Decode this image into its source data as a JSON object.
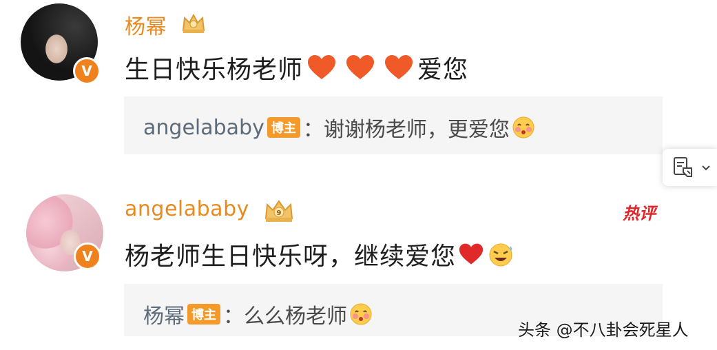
{
  "comments": [
    {
      "username": "杨幂",
      "text": "生日快乐杨老师",
      "text_suffix": "爱您",
      "heart_count": 3,
      "reply": {
        "user": "angelababy",
        "tag": "博主",
        "separator": "：",
        "text": "谢谢杨老师，更爱您"
      }
    },
    {
      "username": "angelababy",
      "hot_label": "热评",
      "text": "杨老师生日快乐呀，继续爱您",
      "crown_level": "9",
      "reply": {
        "user": "杨幂",
        "tag": "博主",
        "separator": "：",
        "text": "么么杨老师"
      }
    }
  ],
  "watermark": "头条 @不八卦会死星人",
  "colors": {
    "username": "#e9891e",
    "heart": "#f05a28",
    "badge": "#f0821e",
    "hot": "#e0262b",
    "reply_bg": "#f5f5f5",
    "reply_user": "#5e6b7a"
  },
  "icons": {
    "verified_badge": "V",
    "crown": "crown-icon",
    "emoji_blush": "blush-emoji-icon",
    "emoji_cry_laugh": "teary-laugh-emoji-icon",
    "doc_widget": "document-icon"
  }
}
